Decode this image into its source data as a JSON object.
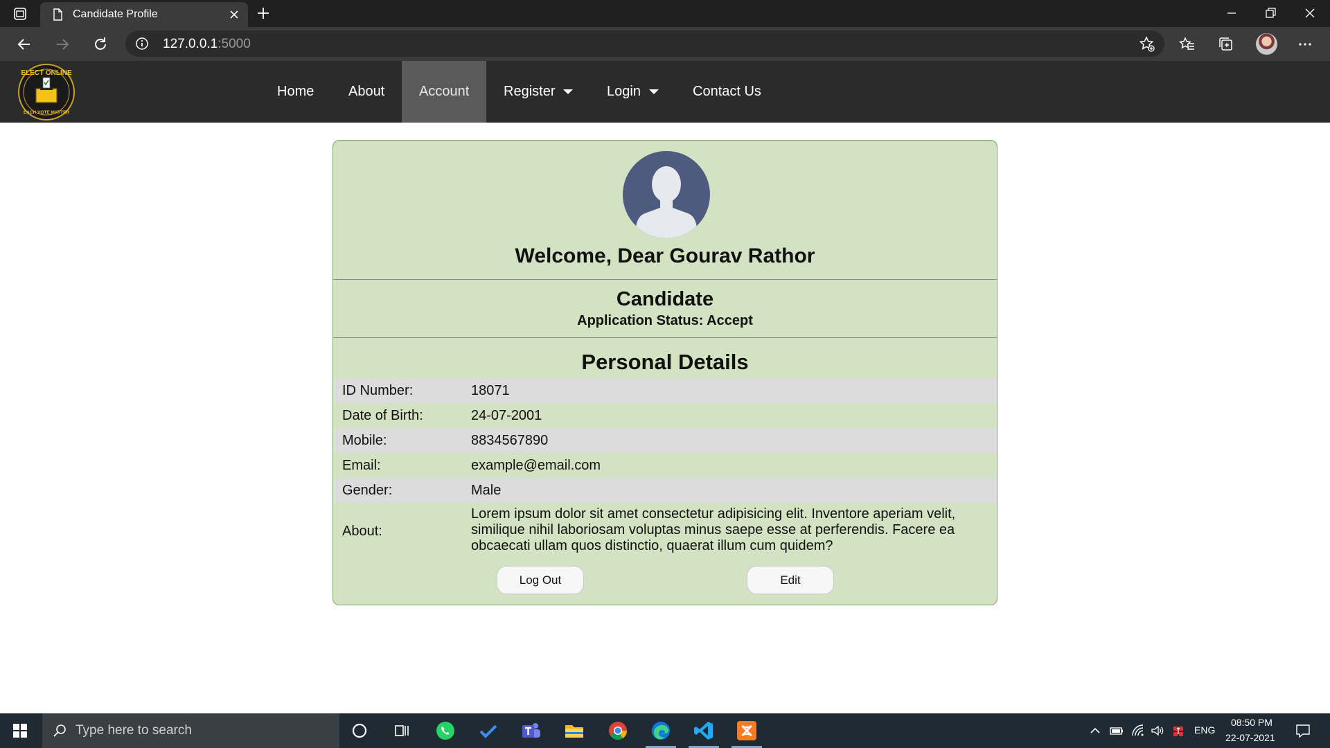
{
  "browser": {
    "tab_title": "Candidate Profile",
    "url_host": "127.0.0.1",
    "url_port": ":5000"
  },
  "site_nav": {
    "logo_text_top": "ELECT ONLINE",
    "logo_text_bottom": "EACH VOTE MATTER",
    "items": [
      {
        "label": "Home"
      },
      {
        "label": "About"
      },
      {
        "label": "Account",
        "active": true
      },
      {
        "label": "Register",
        "dropdown": true
      },
      {
        "label": "Login",
        "dropdown": true
      },
      {
        "label": "Contact Us"
      }
    ]
  },
  "profile": {
    "welcome": "Welcome, Dear Gourav Rathor",
    "role": "Candidate",
    "status": "Application Status: Accept",
    "section_title": "Personal Details",
    "details": [
      {
        "label": "ID Number:",
        "value": "18071"
      },
      {
        "label": "Date of Birth:",
        "value": "24-07-2001"
      },
      {
        "label": "Mobile:",
        "value": "8834567890"
      },
      {
        "label": "Email:",
        "value": "example@email.com"
      },
      {
        "label": "Gender:",
        "value": "Male"
      },
      {
        "label": "About:",
        "value": "Lorem ipsum dolor sit amet consectetur adipisicing elit. Inventore aperiam velit, similique nihil laboriosam voluptas minus saepe esse at perferendis. Facere ea obcaecati ullam quos distinctio, quaerat illum cum quidem?"
      }
    ],
    "logout_label": "Log Out",
    "edit_label": "Edit"
  },
  "taskbar": {
    "search_placeholder": "Type here to search",
    "language": "ENG",
    "time": "08:50 PM",
    "date": "22-07-2021"
  },
  "colors": {
    "card_bg": "#d2e2c2",
    "nav_bg": "#2b2b2b",
    "nav_active": "#5a5a5a",
    "row_shade": "#dcdcdc",
    "avatar": "#4f5a7f"
  }
}
